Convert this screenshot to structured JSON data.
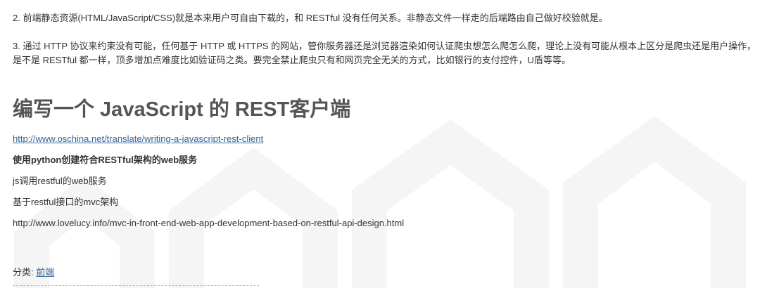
{
  "paragraphs": {
    "p2": "2. 前端静态资源(HTML/JavaScript/CSS)就是本来用户可自由下载的，和 RESTful 没有任何关系。非静态文件一样走的后端路由自己做好校验就是。",
    "p3_line1": "3. 通过 HTTP 协议来约束没有可能，任何基于 HTTP 或 HTTPS 的网站，管你服务器还是浏览器渲染如何认证爬虫想怎么爬怎么爬，理论上没有可能从根本上区分是爬虫还是用户操作，",
    "p3_line2": "是不是 RESTful 都一样，顶多增加点难度比如验证码之类。要完全禁止爬虫只有和网页完全无关的方式，比如银行的支付控件，U盾等等。"
  },
  "section": {
    "heading": "编写一个 JavaScript 的 REST客户端",
    "link_text": "http://www.oschina.net/translate/writing-a-javascript-rest-client",
    "bold_line": "使用python创建符合RESTful架构的web服务",
    "line_js": "js调用restful的web服务",
    "line_mvc": "基于restful接口的mvc架构",
    "line_url": "http://www.lovelucy.info/mvc-in-front-end-web-app-development-based-on-restful-api-design.html"
  },
  "category": {
    "label": "分类: ",
    "link_text": "前端"
  },
  "colors": {
    "link": "#336699",
    "heading": "#555555",
    "text": "#333333",
    "watermark": "#f4f4f4"
  }
}
